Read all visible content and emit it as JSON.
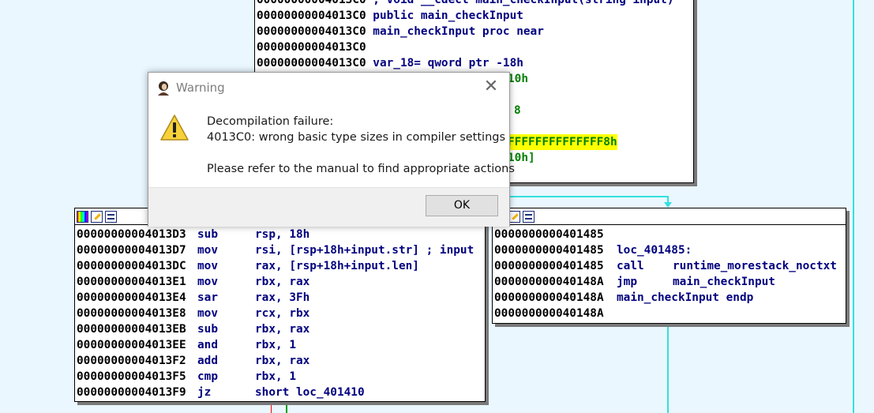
{
  "top_block": {
    "lines": [
      {
        "addr": "00000000004013C0",
        "text": " ; void __cdecl main_checkInput(string input)"
      },
      {
        "addr": "00000000004013C0",
        "text": " public main_checkInput"
      },
      {
        "addr": "00000000004013C0",
        "text": " main_checkInput proc near"
      },
      {
        "addr": "00000000004013C0",
        "text": ""
      },
      {
        "addr": "00000000004013C0",
        "text": " var_18= qword ptr -18h"
      },
      {
        "addr": "",
        "text": "10h"
      },
      {
        "addr": "",
        "text": ""
      },
      {
        "addr": "",
        "text": "8"
      },
      {
        "addr": "",
        "text": ""
      },
      {
        "addr": "",
        "text": "FFFFFFFFFFFFFF8h"
      },
      {
        "addr": "",
        "text": "10h]"
      }
    ]
  },
  "left_block": {
    "lines": [
      {
        "addr": "00000000004013D3",
        "mn": "sub",
        "op": "rsp, 18h"
      },
      {
        "addr": "00000000004013D7",
        "mn": "mov",
        "op": "rsi, [rsp+18h+input.str] ; input"
      },
      {
        "addr": "00000000004013DC",
        "mn": "mov",
        "op": "rax, [rsp+18h+input.len]"
      },
      {
        "addr": "00000000004013E1",
        "mn": "mov",
        "op": "rbx, rax"
      },
      {
        "addr": "00000000004013E4",
        "mn": "sar",
        "op": "rax, 3Fh"
      },
      {
        "addr": "00000000004013E8",
        "mn": "mov",
        "op": "rcx, rbx"
      },
      {
        "addr": "00000000004013EB",
        "mn": "sub",
        "op": "rbx, rax"
      },
      {
        "addr": "00000000004013EE",
        "mn": "and",
        "op": "rbx, 1"
      },
      {
        "addr": "00000000004013F2",
        "mn": "add",
        "op": "rbx, rax"
      },
      {
        "addr": "00000000004013F5",
        "mn": "cmp",
        "op": "rbx, 1"
      },
      {
        "addr": "00000000004013F9",
        "mn": "jz",
        "op": "short loc_401410"
      }
    ]
  },
  "right_block": {
    "lines": [
      {
        "addr": "0000000000401485",
        "mn": "",
        "op": ""
      },
      {
        "addr": "0000000000401485",
        "mn": "loc_401485:",
        "op": ""
      },
      {
        "addr": "0000000000401485",
        "mn": "call",
        "op": "runtime_morestack_noctxt"
      },
      {
        "addr": "000000000040148A",
        "mn": "jmp",
        "op": "main_checkInput"
      },
      {
        "addr": "000000000040148A",
        "mn": "main_checkInput endp",
        "op": ""
      },
      {
        "addr": "000000000040148A",
        "mn": "",
        "op": ""
      }
    ]
  },
  "dialog": {
    "title": "Warning",
    "close": "✕",
    "message_line1": "Decompilation failure:",
    "message_line2": "4013C0: wrong basic type sizes in compiler settings",
    "message_line3": "",
    "message_line4": "Please refer to the manual to find appropriate actions",
    "ok_label": "OK"
  },
  "colors": {
    "graph_bg": "#eaf7ff",
    "edge_cyan": "#33e0e0",
    "edge_red": "#ff0000",
    "edge_green": "#00a000",
    "mnemonic": "#00007f",
    "number": "#007f00",
    "highlight": "#ffff00"
  }
}
